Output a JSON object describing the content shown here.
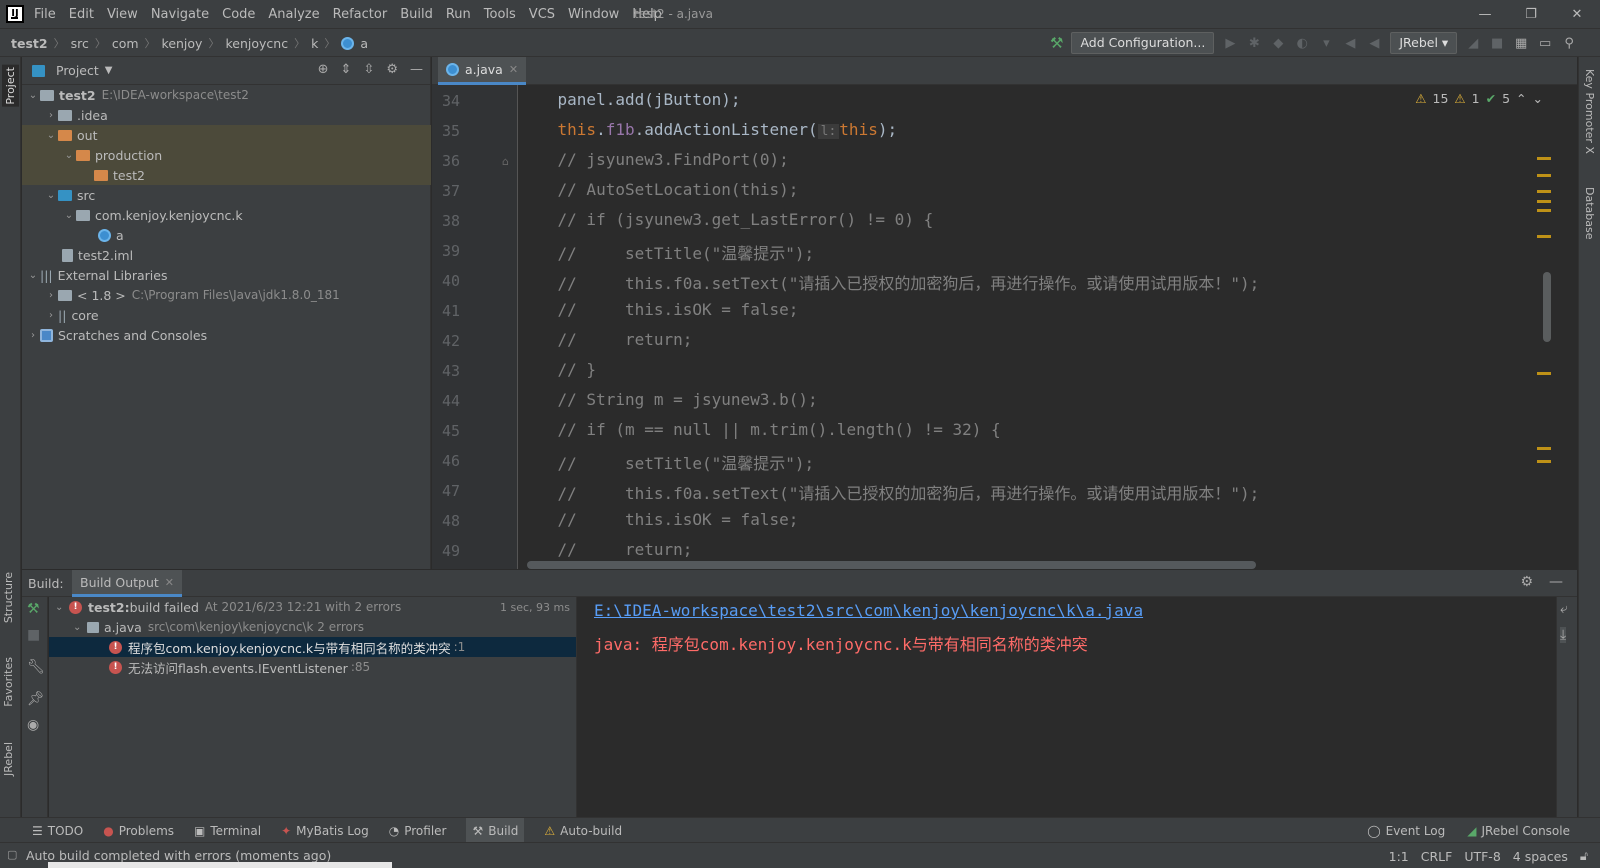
{
  "app": {
    "menu": [
      "File",
      "Edit",
      "View",
      "Navigate",
      "Code",
      "Analyze",
      "Refactor",
      "Build",
      "Run",
      "Tools",
      "VCS",
      "Window",
      "Help"
    ],
    "window_title": "test2 - a.java"
  },
  "navbar": {
    "breadcrumbs": [
      "test2",
      "src",
      "com",
      "kenjoy",
      "kenjoycnc",
      "k",
      "a"
    ],
    "add_configuration": "Add Configuration...",
    "jrebel": "JRebel"
  },
  "left_strip": {
    "project": "Project",
    "structure": "Structure",
    "favorites": "Favorites",
    "jrebel": "JRebel"
  },
  "right_strip": {
    "key_promoter": "Key Promoter X",
    "database": "Database"
  },
  "project_panel": {
    "title": "Project",
    "tree": [
      {
        "label": "test2",
        "hint": "E:\\IDEA-workspace\\test2"
      },
      {
        "label": ".idea",
        "hint": ""
      },
      {
        "label": "out",
        "hint": ""
      },
      {
        "label": "production",
        "hint": ""
      },
      {
        "label": "test2",
        "hint": ""
      },
      {
        "label": "src",
        "hint": ""
      },
      {
        "label": "com.kenjoy.kenjoycnc.k",
        "hint": ""
      },
      {
        "label": "a",
        "hint": ""
      },
      {
        "label": "test2.iml",
        "hint": ""
      },
      {
        "label": "External Libraries",
        "hint": ""
      },
      {
        "label": "< 1.8 >",
        "hint": "C:\\Program Files\\Java\\jdk1.8.0_181"
      },
      {
        "label": "core",
        "hint": ""
      },
      {
        "label": "Scratches and Consoles",
        "hint": ""
      }
    ]
  },
  "editor": {
    "tab": "a.java",
    "inspections": {
      "warnings": "15",
      "weak": "1",
      "ok": "5"
    },
    "line_numbers": [
      "34",
      "35",
      "36",
      "37",
      "38",
      "39",
      "40",
      "41",
      "42",
      "43",
      "44",
      "45",
      "46",
      "47",
      "48",
      "49"
    ],
    "lines": [
      "    panel.add(jButton);",
      "    this.f1b.addActionListener(",
      "    // jsyunew3.FindPort(0);",
      "    // AutoSetLocation(this);",
      "    // if (jsyunew3.get_LastError() != 0) {",
      "    //     setTitle(\"温馨提示\");",
      "    //     this.f0a.setText(\"请插入已授权的加密狗后，再进行操作。或请使用试用版本！\");",
      "    //     this.isOK = false;",
      "    //     return;",
      "    // }",
      "    // String m = jsyunew3.b();",
      "    // if (m == null || m.trim().length() != 32) {",
      "    //     setTitle(\"温馨提示\");",
      "    //     this.f0a.setText(\"请插入已授权的加密狗后，再进行操作。或请使用试用版本！\");",
      "    //     this.isOK = false;",
      "    //     return;"
    ],
    "line35_hint": "l:",
    "line35_this": "this",
    "line35_end": ");"
  },
  "build": {
    "label": "Build:",
    "tab": "Build Output",
    "tree": [
      {
        "bold": "test2:",
        "text": " build failed",
        "hint": "At 2021/6/23 12:21 with 2 errors",
        "time": "1 sec, 93 ms"
      },
      {
        "bold": "",
        "text": "a.java",
        "hint": "src\\com\\kenjoy\\kenjoycnc\\k 2 errors",
        "time": ""
      },
      {
        "bold": "",
        "text": "程序包com.kenjoy.kenjoycnc.k与带有相同名称的类冲突",
        "hint": ":1",
        "time": ""
      },
      {
        "bold": "",
        "text": "无法访问flash.events.IEventListener",
        "hint": ":85",
        "time": ""
      }
    ],
    "output_path": "E:\\IDEA-workspace\\test2\\src\\com\\kenjoy\\kenjoycnc\\k\\a.java",
    "output_error_prefix": "java: ",
    "output_error": "程序包com.kenjoy.kenjoycnc.k与带有相同名称的类冲突"
  },
  "tool_windows": {
    "left": [
      "TODO",
      "Problems",
      "Terminal",
      "MyBatis Log",
      "Profiler",
      "Build",
      "Auto-build"
    ],
    "right": [
      "Event Log",
      "JRebel Console"
    ]
  },
  "status": {
    "text": "Auto build completed with errors (moments ago)",
    "position": "1:1",
    "line_sep": "CRLF",
    "encoding": "UTF-8",
    "indent": "4 spaces"
  },
  "colors": {
    "accent": "#4a88c7",
    "error": "#c75450",
    "warning": "#e2b33a",
    "ok": "#59a869"
  }
}
